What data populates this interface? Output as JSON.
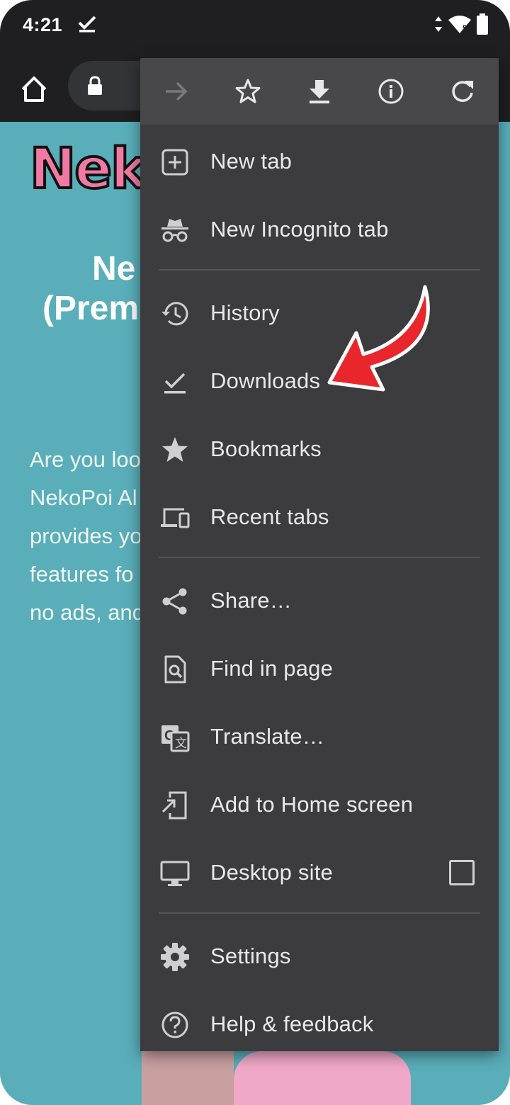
{
  "status_bar": {
    "time": "4:21",
    "battery_level": 0.9
  },
  "webpage": {
    "logo_text": "Neko",
    "heading_line1": "Ne",
    "heading_line2": "(Prem",
    "body_lines": [
      "Are you loo",
      "NekoPoi Al",
      "provides yo",
      "features fo",
      "no ads, and"
    ]
  },
  "menu": {
    "top_icons": [
      "forward-icon",
      "star-icon",
      "download-icon",
      "info-icon",
      "refresh-icon"
    ],
    "items": [
      {
        "label": "New tab",
        "icon": "plus-box-icon"
      },
      {
        "label": "New Incognito tab",
        "icon": "incognito-icon"
      },
      {
        "label": "History",
        "icon": "history-icon"
      },
      {
        "label": "Downloads",
        "icon": "download-check-icon"
      },
      {
        "label": "Bookmarks",
        "icon": "star-filled-icon"
      },
      {
        "label": "Recent tabs",
        "icon": "devices-icon"
      },
      {
        "label": "Share…",
        "icon": "share-icon"
      },
      {
        "label": "Find in page",
        "icon": "find-in-page-icon"
      },
      {
        "label": "Translate…",
        "icon": "translate-icon"
      },
      {
        "label": "Add to Home screen",
        "icon": "add-to-home-icon"
      },
      {
        "label": "Desktop site",
        "icon": "desktop-icon",
        "checked": false
      },
      {
        "label": "Settings",
        "icon": "gear-icon"
      },
      {
        "label": "Help & feedback",
        "icon": "help-icon"
      }
    ]
  },
  "colors": {
    "menu_bg": "#3c3c3f",
    "page_bg": "#5aaeb9",
    "arrow": "#e8262b"
  }
}
